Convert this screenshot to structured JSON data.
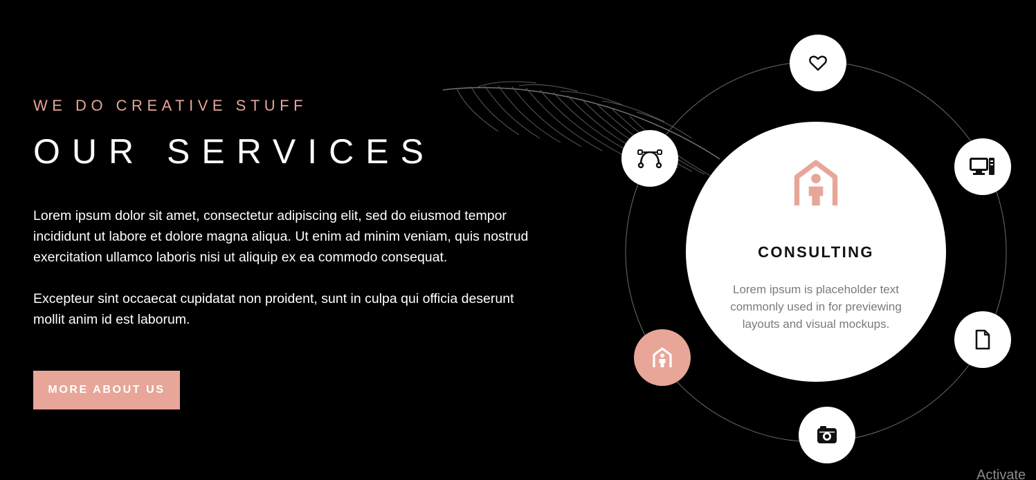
{
  "hero": {
    "kicker": "WE DO CREATIVE STUFF",
    "title": "OUR SERVICES",
    "paragraph_1": "Lorem ipsum dolor sit amet, consectetur adipiscing elit, sed do eiusmod tempor incididunt ut labore et dolore magna aliqua. Ut enim ad minim veniam, quis nostrud exercitation ullamco laboris nisi ut aliquip ex ea commodo consequat.",
    "paragraph_2": "Excepteur sint occaecat cupidatat non proident, sunt in culpa qui officia deserunt mollit anim id est laborum.",
    "cta_label": "MORE ABOUT US"
  },
  "services": {
    "active": "consulting",
    "items": [
      {
        "id": "favorites",
        "icon": "heart-icon"
      },
      {
        "id": "computer",
        "icon": "computer-icon"
      },
      {
        "id": "document",
        "icon": "file-icon"
      },
      {
        "id": "camera",
        "icon": "camera-icon"
      },
      {
        "id": "consulting",
        "icon": "consulting-home-icon"
      },
      {
        "id": "vector-design",
        "icon": "vector-pen-icon"
      }
    ],
    "detail": {
      "title": "CONSULTING",
      "text": "Lorem ipsum is placeholder text commonly used in for previewing layouts and visual mockups."
    }
  },
  "watermark": "Activate",
  "colors": {
    "background": "#000000",
    "accent": "#e8a698",
    "text": "#ffffff",
    "muted": "#7a7a7a"
  }
}
